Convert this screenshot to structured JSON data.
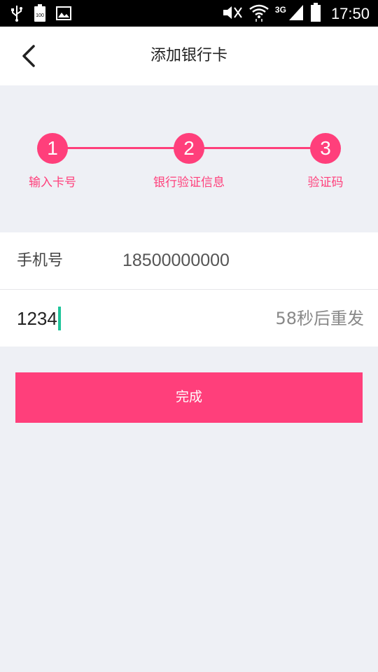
{
  "status_bar": {
    "time": "17:50",
    "network": "3G",
    "battery_text": "100",
    "icons": [
      "usb-icon",
      "battery-icon",
      "image-icon",
      "mute-icon",
      "wifi-icon",
      "signal-icon",
      "battery-full-icon"
    ]
  },
  "header": {
    "title": "添加银行卡",
    "back_icon": "chevron-left-icon"
  },
  "stepper": {
    "steps": [
      {
        "number": "1",
        "label": "输入卡号"
      },
      {
        "number": "2",
        "label": "银行验证信息"
      },
      {
        "number": "3",
        "label": "验证码"
      }
    ],
    "accent": "#ff3f7b"
  },
  "form": {
    "phone_label": "手机号",
    "phone_value": "18500000000",
    "code_value": "1234",
    "resend_label": "58秒后重发"
  },
  "actions": {
    "done_label": "完成"
  },
  "colors": {
    "accent": "#ff3f7b",
    "caret": "#1ec49a",
    "background": "#eef0f5"
  }
}
